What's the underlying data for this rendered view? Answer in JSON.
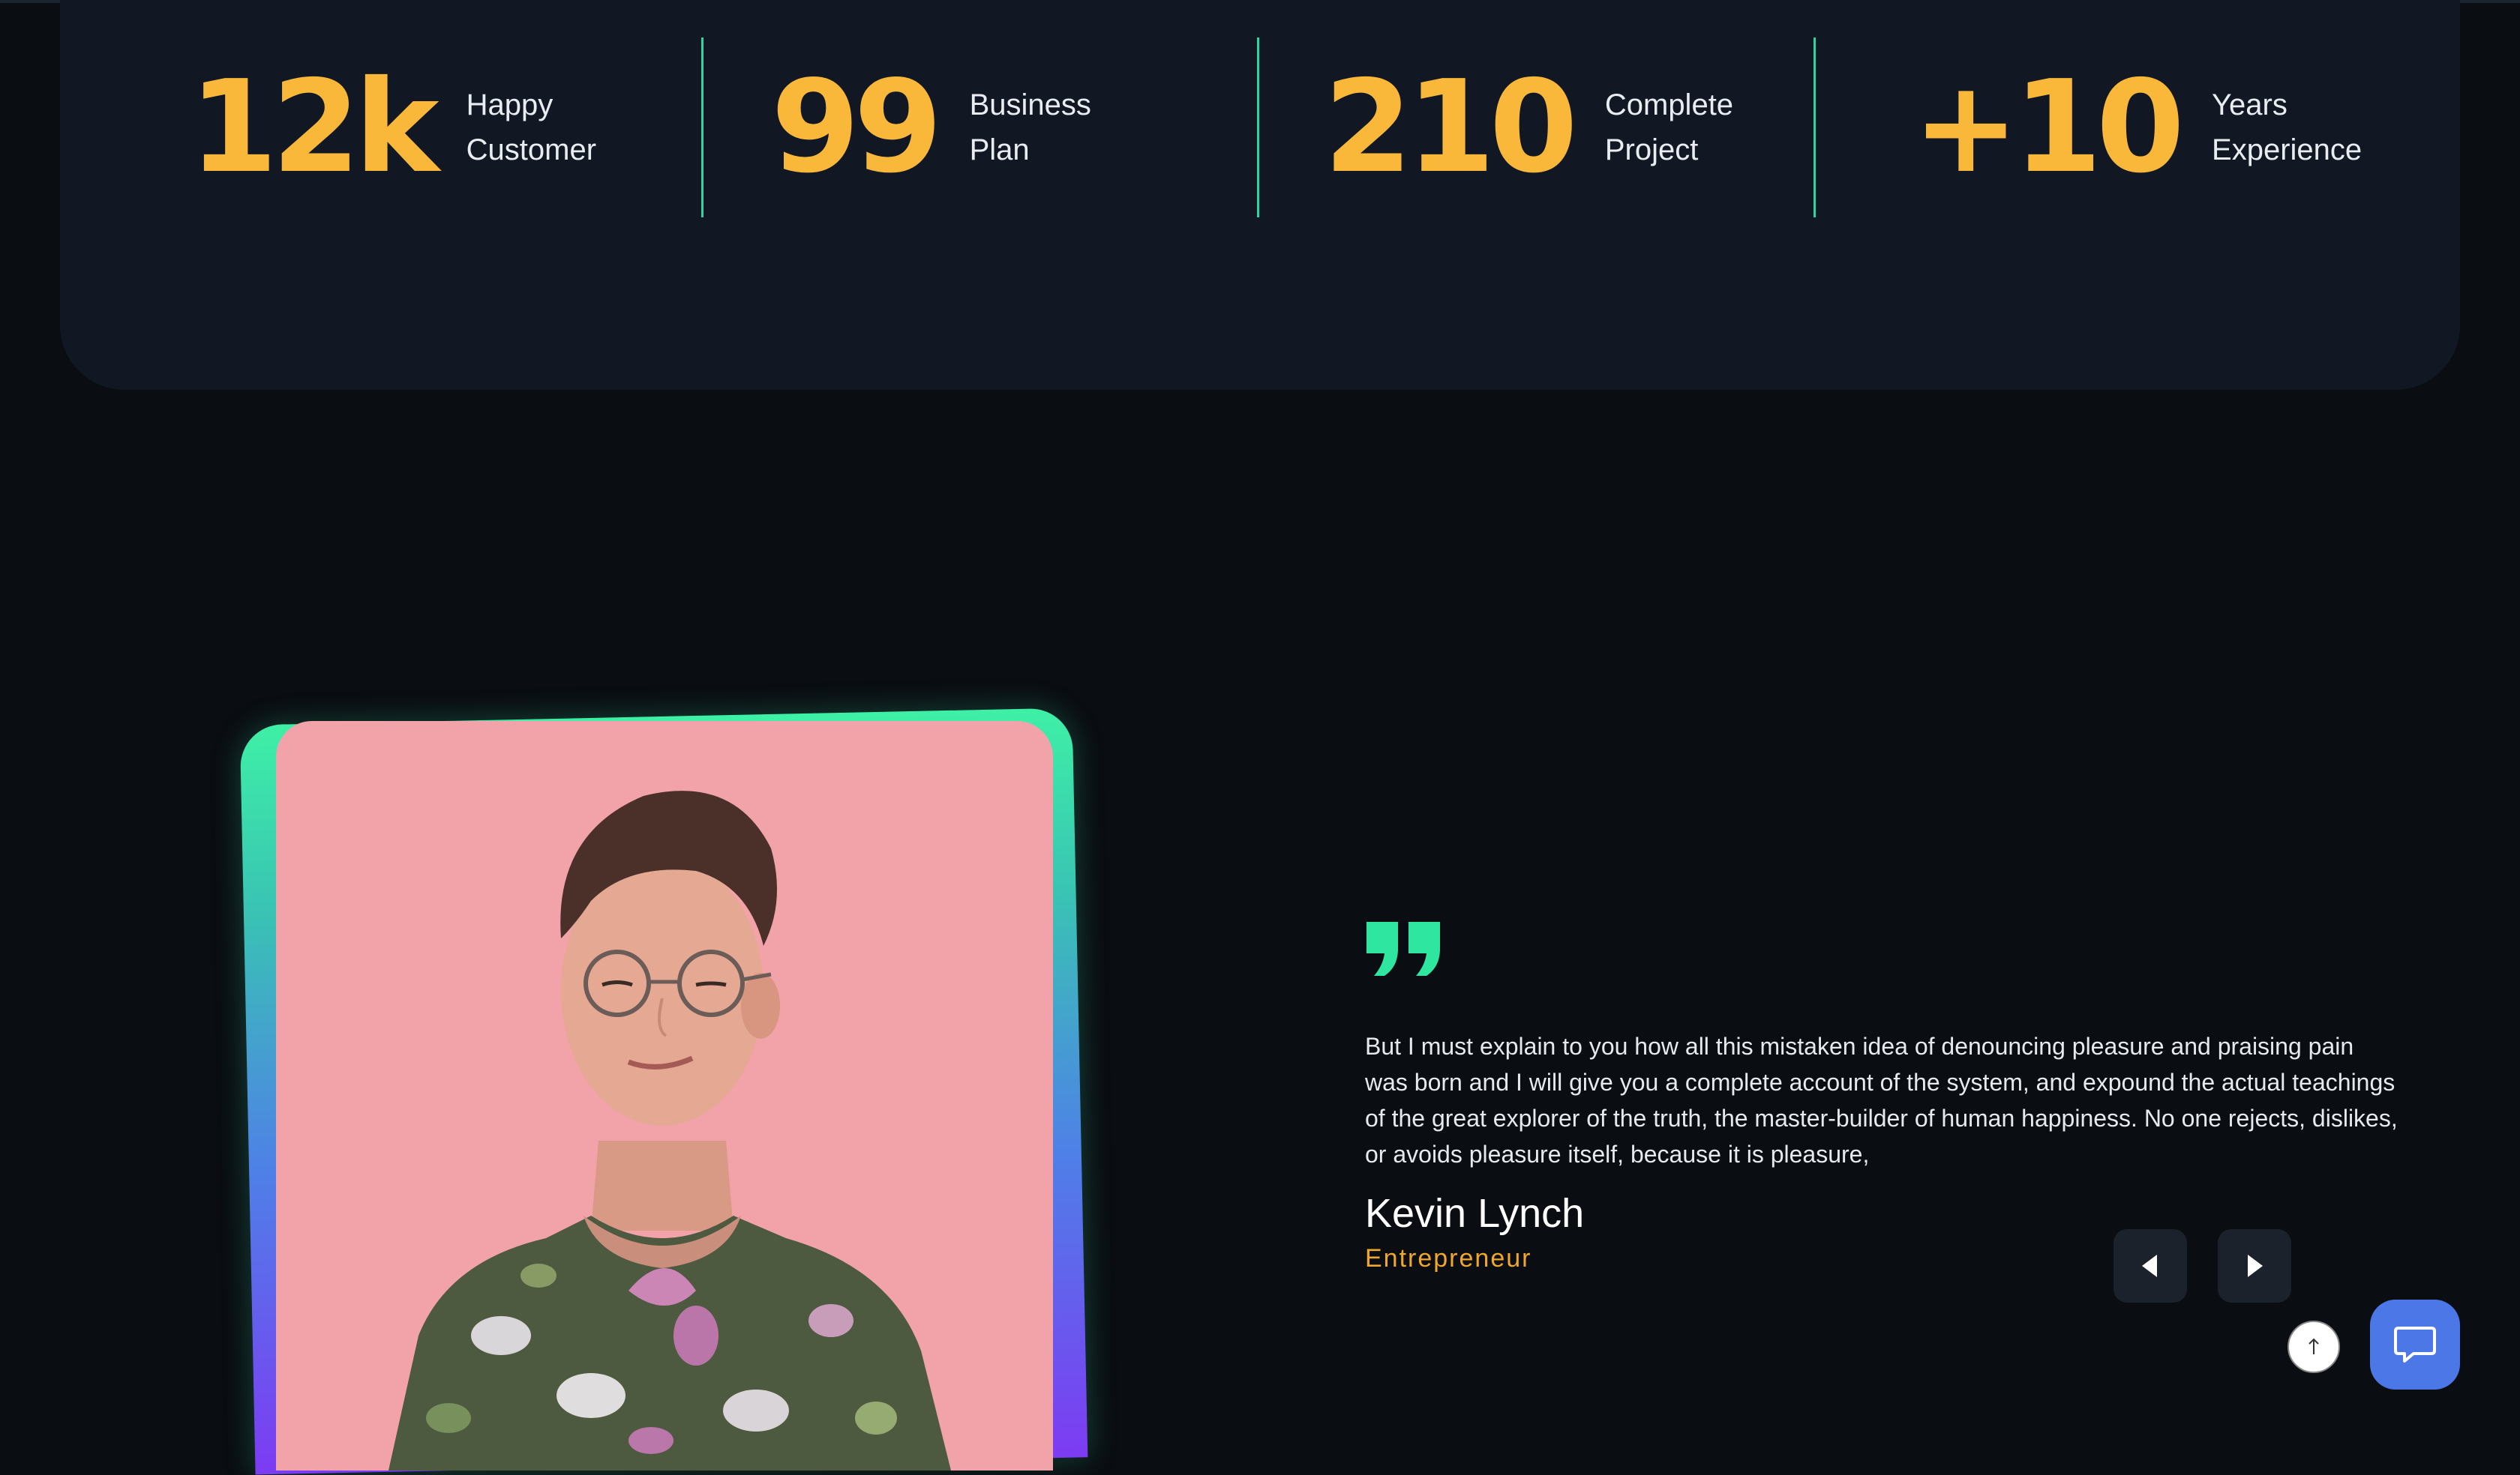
{
  "stats": [
    {
      "number": "12k",
      "label_line1": "Happy",
      "label_line2": "Customer"
    },
    {
      "number": "99",
      "label_line1": "Business",
      "label_line2": "Plan"
    },
    {
      "number": "210",
      "label_line1": "Complete",
      "label_line2": "Project"
    },
    {
      "number": "+10",
      "label_line1": "Years",
      "label_line2": "Experience"
    }
  ],
  "testimonial": {
    "quote": "But I must explain to you how all this mistaken idea of denouncing pleasure and praising pain was born and I will give you a complete account of the system, and expound the actual teachings of the great explorer of the truth, the master-builder of human happiness. No one rejects, dislikes, or avoids pleasure itself, because it is pleasure,",
    "author_name": "Kevin Lynch",
    "author_role": "Entrepreneur"
  },
  "icons": {
    "quote": "quote-icon",
    "prev": "caret-left-icon",
    "next": "caret-right-icon",
    "scroll_top": "arrow-up-icon",
    "chat": "chat-bubble-icon"
  },
  "colors": {
    "accent_yellow": "#f9b83a",
    "accent_green": "#2bd6a0",
    "panel_bg": "#111824",
    "page_bg": "#0a0d12",
    "chat_blue": "#4c77e6"
  }
}
